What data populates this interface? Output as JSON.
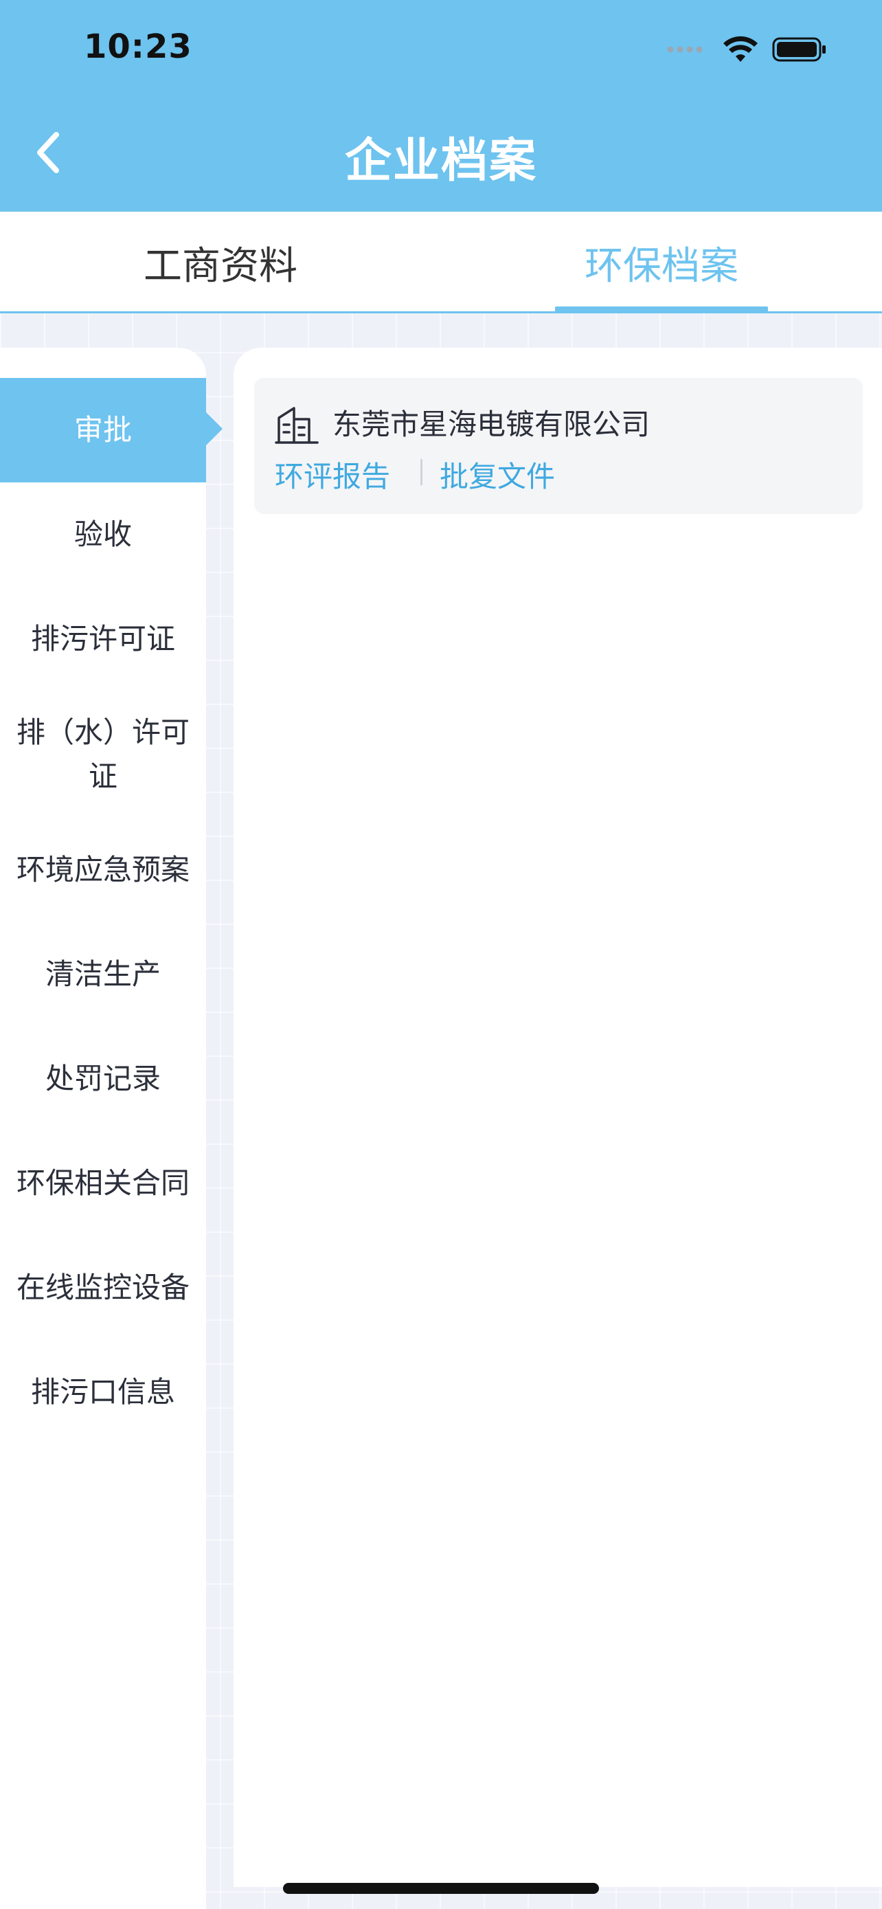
{
  "status_bar": {
    "time": "10:23"
  },
  "header": {
    "title": "企业档案"
  },
  "tabs": [
    {
      "label": "工商资料",
      "active": false
    },
    {
      "label": "环保档案",
      "active": true
    }
  ],
  "sidebar": {
    "items": [
      {
        "label": "审批",
        "active": true
      },
      {
        "label": "验收",
        "active": false
      },
      {
        "label": "排污许可证",
        "active": false
      },
      {
        "label": "排（水）许可证",
        "active": false
      },
      {
        "label": "环境应急预案",
        "active": false
      },
      {
        "label": "清洁生产",
        "active": false
      },
      {
        "label": "处罚记录",
        "active": false
      },
      {
        "label": "环保相关合同",
        "active": false
      },
      {
        "label": "在线监控设备",
        "active": false
      },
      {
        "label": "排污口信息",
        "active": false
      }
    ]
  },
  "card": {
    "company_name": "东莞市星海电镀有限公司",
    "link_report": "环评报告",
    "link_approval": "批复文件"
  },
  "colors": {
    "primary": "#6ec3ef",
    "link": "#3fa9e0",
    "text": "#2b2f3a"
  }
}
